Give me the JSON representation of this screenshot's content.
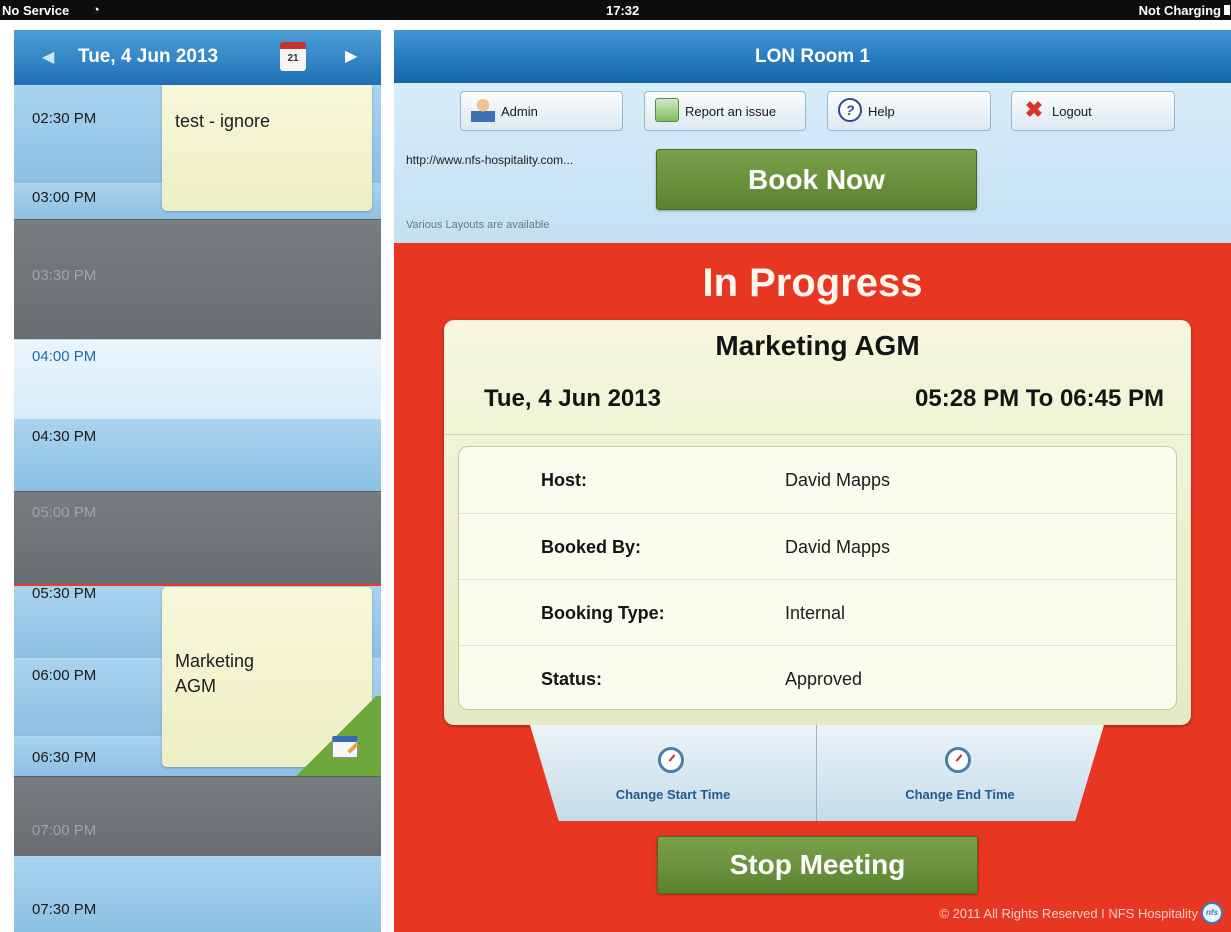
{
  "status_bar": {
    "carrier": "No Service",
    "wifi_icon": "wifi-icon",
    "time": "17:32",
    "charge": "Not Charging"
  },
  "calendar": {
    "date": "Tue, 4 Jun 2013",
    "calendar_icon_day": "21",
    "slots": [
      "02:30 PM",
      "03:00 PM",
      "03:30 PM",
      "04:00 PM",
      "04:30 PM",
      "05:00 PM",
      "05:30 PM",
      "06:00 PM",
      "06:30 PM",
      "07:00 PM",
      "07:30 PM"
    ],
    "events": [
      {
        "title": "test - ignore"
      },
      {
        "title": "Marketing AGM"
      }
    ]
  },
  "room": {
    "name": "LON Room 1"
  },
  "toolbar": {
    "admin": "Admin",
    "report": "Report an issue",
    "help": "Help",
    "logout": "Logout",
    "url": "http://www.nfs-hospitality.com...",
    "layouts_note": "Various Layouts are available",
    "book_now": "Book Now"
  },
  "meeting": {
    "status": "In Progress",
    "title": "Marketing AGM",
    "date": "Tue, 4 Jun 2013",
    "time": "05:28 PM To 06:45 PM",
    "details": [
      {
        "label": "Host:",
        "value": "David Mapps"
      },
      {
        "label": "Booked By:",
        "value": "David Mapps"
      },
      {
        "label": "Booking Type:",
        "value": "Internal"
      },
      {
        "label": "Status:",
        "value": "Approved"
      }
    ],
    "change_start": "Change Start Time",
    "change_end": "Change End Time",
    "stop": "Stop Meeting"
  },
  "footer": {
    "text": "© 2011 All Rights Reserved I NFS Hospitality",
    "logo_text": "nfs"
  },
  "colors": {
    "status_red": "#e73621",
    "brand_blue": "#1f70b4",
    "action_green": "#5b8331"
  }
}
